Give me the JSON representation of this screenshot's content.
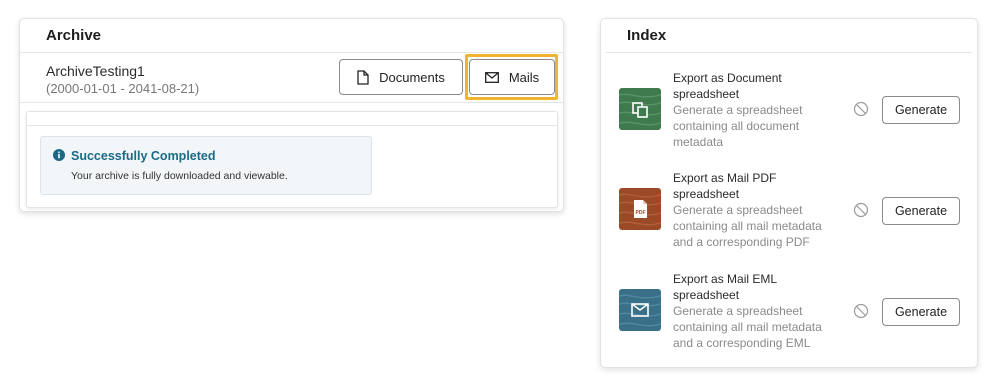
{
  "archive": {
    "title": "Archive",
    "name": "ArchiveTesting1",
    "date_range": "(2000-01-01 - 2041-08-21)",
    "documents_label": "Documents",
    "documents_icon": "document-icon",
    "mails_label": "Mails",
    "mails_icon": "envelope-icon",
    "status": {
      "icon": "info-icon",
      "title": "Successfully Completed",
      "message": "Your archive is fully downloaded and viewable."
    }
  },
  "index": {
    "title": "Index",
    "items": [
      {
        "title": "Export as Document spreadsheet",
        "description": "Generate a spreadsheet containing all document metadata",
        "button": "Generate",
        "thumb_color": "#3f7a4e",
        "thumb_icon": "documents-copy-icon"
      },
      {
        "title": "Export as Mail PDF spreadsheet",
        "description": "Generate a spreadsheet containing all mail metadata and a corresponding PDF",
        "button": "Generate",
        "thumb_color": "#9a4a27",
        "thumb_icon": "pdf-file-icon"
      },
      {
        "title": "Export as Mail EML spreadsheet",
        "description": "Generate a spreadsheet containing all mail metadata and a corresponding EML",
        "button": "Generate",
        "thumb_color": "#3a6f88",
        "thumb_icon": "mail-icon"
      }
    ]
  }
}
